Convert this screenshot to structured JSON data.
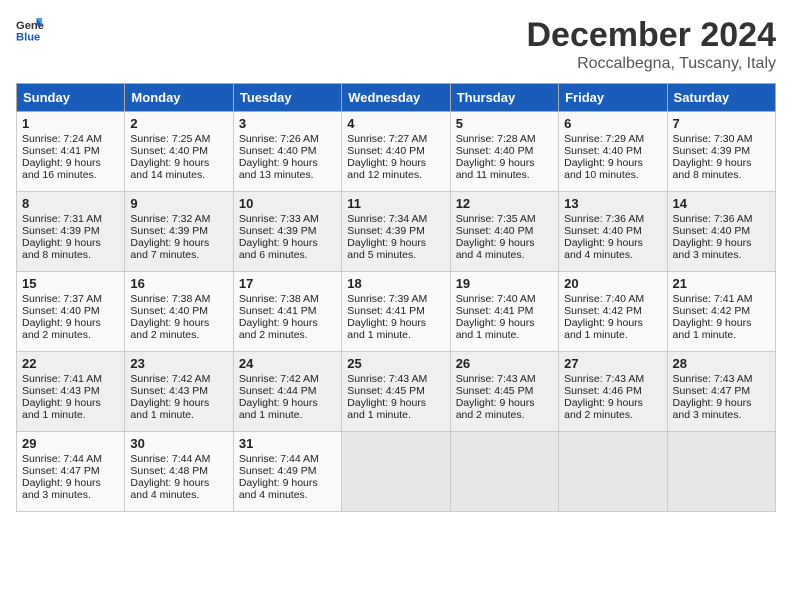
{
  "logo": {
    "line1": "General",
    "line2": "Blue"
  },
  "title": "December 2024",
  "location": "Roccalbegna, Tuscany, Italy",
  "days_of_week": [
    "Sunday",
    "Monday",
    "Tuesday",
    "Wednesday",
    "Thursday",
    "Friday",
    "Saturday"
  ],
  "weeks": [
    [
      {
        "day": "1",
        "info": "Sunrise: 7:24 AM\nSunset: 4:41 PM\nDaylight: 9 hours and 16 minutes."
      },
      {
        "day": "2",
        "info": "Sunrise: 7:25 AM\nSunset: 4:40 PM\nDaylight: 9 hours and 14 minutes."
      },
      {
        "day": "3",
        "info": "Sunrise: 7:26 AM\nSunset: 4:40 PM\nDaylight: 9 hours and 13 minutes."
      },
      {
        "day": "4",
        "info": "Sunrise: 7:27 AM\nSunset: 4:40 PM\nDaylight: 9 hours and 12 minutes."
      },
      {
        "day": "5",
        "info": "Sunrise: 7:28 AM\nSunset: 4:40 PM\nDaylight: 9 hours and 11 minutes."
      },
      {
        "day": "6",
        "info": "Sunrise: 7:29 AM\nSunset: 4:40 PM\nDaylight: 9 hours and 10 minutes."
      },
      {
        "day": "7",
        "info": "Sunrise: 7:30 AM\nSunset: 4:39 PM\nDaylight: 9 hours and 8 minutes."
      }
    ],
    [
      {
        "day": "8",
        "info": "Sunrise: 7:31 AM\nSunset: 4:39 PM\nDaylight: 9 hours and 8 minutes."
      },
      {
        "day": "9",
        "info": "Sunrise: 7:32 AM\nSunset: 4:39 PM\nDaylight: 9 hours and 7 minutes."
      },
      {
        "day": "10",
        "info": "Sunrise: 7:33 AM\nSunset: 4:39 PM\nDaylight: 9 hours and 6 minutes."
      },
      {
        "day": "11",
        "info": "Sunrise: 7:34 AM\nSunset: 4:39 PM\nDaylight: 9 hours and 5 minutes."
      },
      {
        "day": "12",
        "info": "Sunrise: 7:35 AM\nSunset: 4:40 PM\nDaylight: 9 hours and 4 minutes."
      },
      {
        "day": "13",
        "info": "Sunrise: 7:36 AM\nSunset: 4:40 PM\nDaylight: 9 hours and 4 minutes."
      },
      {
        "day": "14",
        "info": "Sunrise: 7:36 AM\nSunset: 4:40 PM\nDaylight: 9 hours and 3 minutes."
      }
    ],
    [
      {
        "day": "15",
        "info": "Sunrise: 7:37 AM\nSunset: 4:40 PM\nDaylight: 9 hours and 2 minutes."
      },
      {
        "day": "16",
        "info": "Sunrise: 7:38 AM\nSunset: 4:40 PM\nDaylight: 9 hours and 2 minutes."
      },
      {
        "day": "17",
        "info": "Sunrise: 7:38 AM\nSunset: 4:41 PM\nDaylight: 9 hours and 2 minutes."
      },
      {
        "day": "18",
        "info": "Sunrise: 7:39 AM\nSunset: 4:41 PM\nDaylight: 9 hours and 1 minute."
      },
      {
        "day": "19",
        "info": "Sunrise: 7:40 AM\nSunset: 4:41 PM\nDaylight: 9 hours and 1 minute."
      },
      {
        "day": "20",
        "info": "Sunrise: 7:40 AM\nSunset: 4:42 PM\nDaylight: 9 hours and 1 minute."
      },
      {
        "day": "21",
        "info": "Sunrise: 7:41 AM\nSunset: 4:42 PM\nDaylight: 9 hours and 1 minute."
      }
    ],
    [
      {
        "day": "22",
        "info": "Sunrise: 7:41 AM\nSunset: 4:43 PM\nDaylight: 9 hours and 1 minute."
      },
      {
        "day": "23",
        "info": "Sunrise: 7:42 AM\nSunset: 4:43 PM\nDaylight: 9 hours and 1 minute."
      },
      {
        "day": "24",
        "info": "Sunrise: 7:42 AM\nSunset: 4:44 PM\nDaylight: 9 hours and 1 minute."
      },
      {
        "day": "25",
        "info": "Sunrise: 7:43 AM\nSunset: 4:45 PM\nDaylight: 9 hours and 1 minute."
      },
      {
        "day": "26",
        "info": "Sunrise: 7:43 AM\nSunset: 4:45 PM\nDaylight: 9 hours and 2 minutes."
      },
      {
        "day": "27",
        "info": "Sunrise: 7:43 AM\nSunset: 4:46 PM\nDaylight: 9 hours and 2 minutes."
      },
      {
        "day": "28",
        "info": "Sunrise: 7:43 AM\nSunset: 4:47 PM\nDaylight: 9 hours and 3 minutes."
      }
    ],
    [
      {
        "day": "29",
        "info": "Sunrise: 7:44 AM\nSunset: 4:47 PM\nDaylight: 9 hours and 3 minutes."
      },
      {
        "day": "30",
        "info": "Sunrise: 7:44 AM\nSunset: 4:48 PM\nDaylight: 9 hours and 4 minutes."
      },
      {
        "day": "31",
        "info": "Sunrise: 7:44 AM\nSunset: 4:49 PM\nDaylight: 9 hours and 4 minutes."
      },
      {
        "day": "",
        "info": ""
      },
      {
        "day": "",
        "info": ""
      },
      {
        "day": "",
        "info": ""
      },
      {
        "day": "",
        "info": ""
      }
    ]
  ]
}
